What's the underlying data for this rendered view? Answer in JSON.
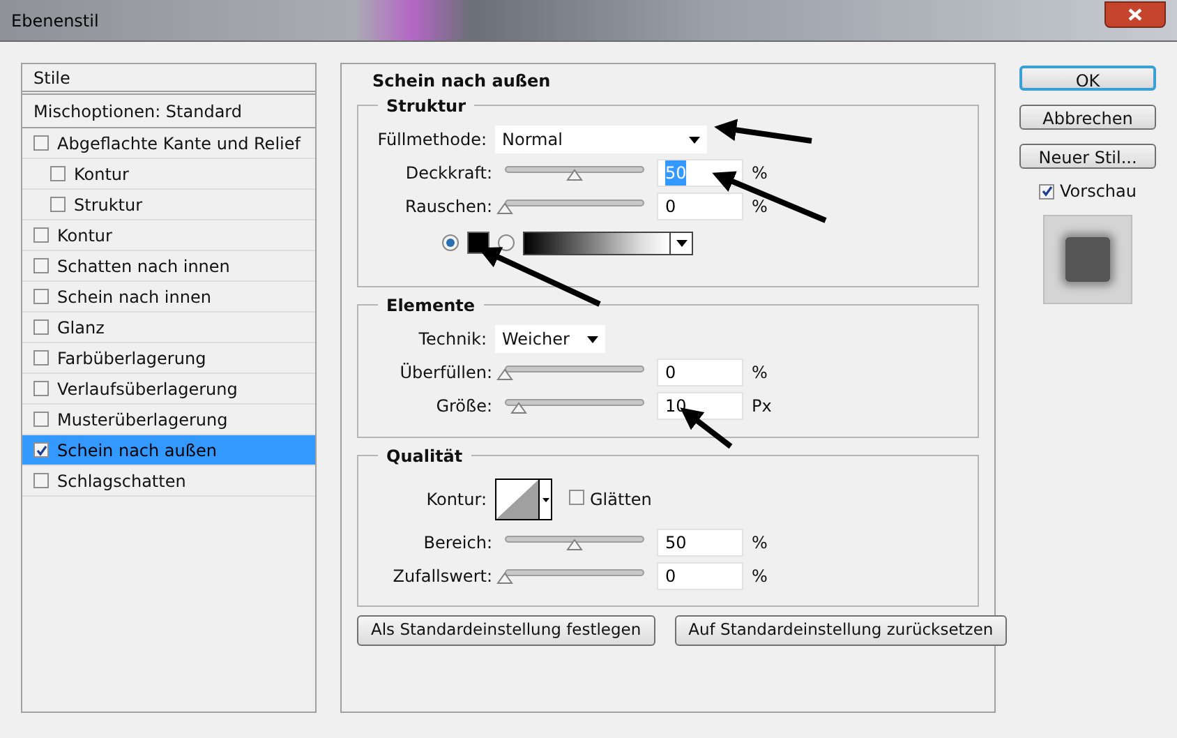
{
  "window": {
    "title": "Ebenenstil"
  },
  "styles_panel": {
    "header": "Stile",
    "blend_options": "Mischoptionen: Standard",
    "items": [
      {
        "label": "Abgeflachte Kante und Relief",
        "checked": false,
        "selected": false,
        "children": [
          {
            "label": "Kontur",
            "checked": false,
            "selected": false
          },
          {
            "label": "Struktur",
            "checked": false,
            "selected": false
          }
        ]
      },
      {
        "label": "Kontur",
        "checked": false,
        "selected": false
      },
      {
        "label": "Schatten nach innen",
        "checked": false,
        "selected": false
      },
      {
        "label": "Schein nach innen",
        "checked": false,
        "selected": false
      },
      {
        "label": "Glanz",
        "checked": false,
        "selected": false
      },
      {
        "label": "Farbüberlagerung",
        "checked": false,
        "selected": false
      },
      {
        "label": "Verlaufsüberlagerung",
        "checked": false,
        "selected": false
      },
      {
        "label": "Musterüberlagerung",
        "checked": false,
        "selected": false
      },
      {
        "label": "Schein nach außen",
        "checked": true,
        "selected": true
      },
      {
        "label": "Schlagschatten",
        "checked": false,
        "selected": false
      }
    ]
  },
  "main": {
    "title": "Schein nach außen",
    "structure": {
      "title": "Struktur",
      "blend_mode": {
        "label": "Füllmethode:",
        "value": "Normal"
      },
      "sliders": [
        {
          "label": "Deckkraft:",
          "level": 0.5,
          "value": "50",
          "unit": "%",
          "highlighted": true
        },
        {
          "label": "Rauschen:",
          "level": 0,
          "value": "0",
          "unit": "%",
          "highlighted": false
        }
      ],
      "fill": [
        {
          "kind": "color",
          "selected": true,
          "color": "#000000"
        },
        {
          "kind": "gradient",
          "selected": false
        }
      ]
    },
    "elements": {
      "title": "Elemente",
      "technique": {
        "label": "Technik:",
        "value": "Weicher"
      },
      "sliders": [
        {
          "label": "Überfüllen:",
          "level": 0,
          "value": "0",
          "unit": "%",
          "highlighted": false
        },
        {
          "label": "Größe:",
          "level": 0.1,
          "value": "10",
          "unit": "Px",
          "highlighted": false
        }
      ]
    },
    "quality": {
      "title": "Qualität",
      "contour_label": "Kontur:",
      "antialias": {
        "label": "Glätten",
        "checked": false
      },
      "sliders": [
        {
          "label": "Bereich:",
          "level": 0.5,
          "value": "50",
          "unit": "%",
          "highlighted": false
        },
        {
          "label": "Zufallswert:",
          "level": 0,
          "value": "0",
          "unit": "%",
          "highlighted": false
        }
      ]
    },
    "buttons": [
      "Als Standardeinstellung festlegen",
      "Auf Standardeinstellung zurücksetzen"
    ]
  },
  "side": {
    "buttons": [
      {
        "label": "OK",
        "default": true
      },
      {
        "label": "Abbrechen",
        "default": false
      },
      {
        "label": "Neuer Stil...",
        "default": false
      }
    ],
    "preview": {
      "label": "Vorschau",
      "checked": true
    }
  }
}
